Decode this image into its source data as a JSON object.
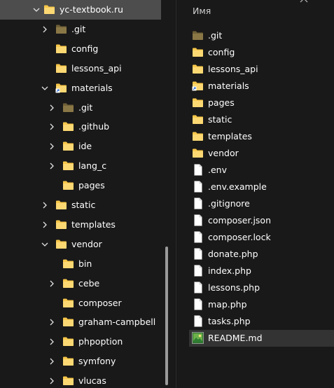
{
  "tree": {
    "items": [
      {
        "label": "yc-textbook.ru",
        "icon": "folder-icon",
        "expanded": true,
        "selected": true
      },
      {
        "label": ".git",
        "icon": "folder-dark-icon",
        "expanded": false
      },
      {
        "label": "config",
        "icon": "folder-icon"
      },
      {
        "label": "lessons_api",
        "icon": "folder-icon"
      },
      {
        "label": "materials",
        "icon": "folder-shortcut-icon",
        "expanded": true
      },
      {
        "label": ".git",
        "icon": "folder-dark-icon",
        "expanded": false
      },
      {
        "label": ".github",
        "icon": "folder-icon",
        "expanded": false
      },
      {
        "label": "ide",
        "icon": "folder-icon",
        "expanded": false
      },
      {
        "label": "lang_c",
        "icon": "folder-icon",
        "expanded": false
      },
      {
        "label": "pages",
        "icon": "folder-icon"
      },
      {
        "label": "static",
        "icon": "folder-icon",
        "expanded": false
      },
      {
        "label": "templates",
        "icon": "folder-icon",
        "expanded": false
      },
      {
        "label": "vendor",
        "icon": "folder-icon",
        "expanded": true
      },
      {
        "label": "bin",
        "icon": "folder-icon"
      },
      {
        "label": "cebe",
        "icon": "folder-icon",
        "expanded": false
      },
      {
        "label": "composer",
        "icon": "folder-icon"
      },
      {
        "label": "graham-campbell",
        "icon": "folder-icon",
        "expanded": false
      },
      {
        "label": "phpoption",
        "icon": "folder-icon",
        "expanded": false
      },
      {
        "label": "symfony",
        "icon": "folder-icon",
        "expanded": false
      },
      {
        "label": "vlucas",
        "icon": "folder-icon",
        "expanded": false
      }
    ]
  },
  "list": {
    "column_header": "Имя",
    "items": [
      {
        "label": ".git",
        "icon": "folder-dark-icon"
      },
      {
        "label": "config",
        "icon": "folder-icon"
      },
      {
        "label": "lessons_api",
        "icon": "folder-icon"
      },
      {
        "label": "materials",
        "icon": "folder-shortcut-icon"
      },
      {
        "label": "pages",
        "icon": "folder-icon"
      },
      {
        "label": "static",
        "icon": "folder-icon"
      },
      {
        "label": "templates",
        "icon": "folder-icon"
      },
      {
        "label": "vendor",
        "icon": "folder-icon"
      },
      {
        "label": ".env",
        "icon": "file-icon"
      },
      {
        "label": ".env.example",
        "icon": "file-icon"
      },
      {
        "label": ".gitignore",
        "icon": "file-icon"
      },
      {
        "label": "composer.json",
        "icon": "file-icon"
      },
      {
        "label": "composer.lock",
        "icon": "file-icon"
      },
      {
        "label": "donate.php",
        "icon": "file-icon"
      },
      {
        "label": "index.php",
        "icon": "file-icon"
      },
      {
        "label": "lessons.php",
        "icon": "file-icon"
      },
      {
        "label": "map.php",
        "icon": "file-icon"
      },
      {
        "label": "tasks.php",
        "icon": "file-icon"
      },
      {
        "label": "README.md",
        "icon": "image-file-icon",
        "selected": true
      }
    ]
  },
  "colors": {
    "background": "#191919",
    "folder_yellow": "#f8c74a",
    "folder_dark": "#7a6a3c",
    "selection_tree": "#4d4d4d",
    "selection_list": "#333333",
    "text": "#ffffff"
  }
}
